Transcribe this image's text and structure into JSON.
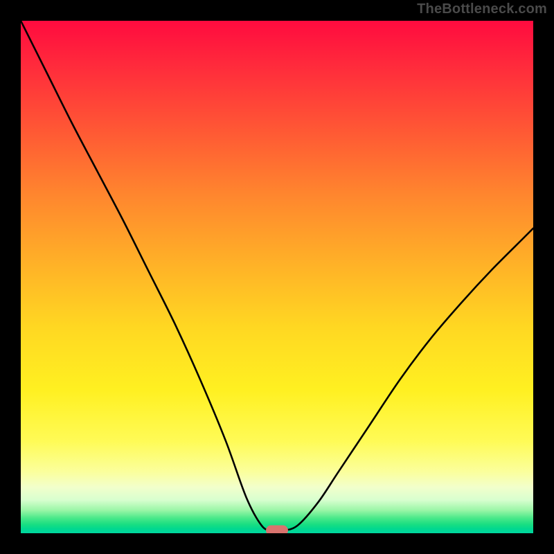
{
  "watermark": "TheBottleneck.com",
  "colors": {
    "frame": "#000000",
    "curve": "#000000",
    "marker": "#d9736e",
    "gradient_top": "#ff0b3f",
    "gradient_bottom": "#00d6a0"
  },
  "chart_data": {
    "type": "line",
    "title": "",
    "xlabel": "",
    "ylabel": "",
    "xlim": [
      0,
      100
    ],
    "ylim": [
      0,
      100
    ],
    "note": "Axes are unlabeled; values are read as percentages of the plot area. y=100 at top, y=0 at bottom.",
    "series": [
      {
        "name": "curve",
        "x": [
          0,
          5,
          10,
          15,
          20,
          25,
          30,
          35,
          40,
          44,
          47,
          49,
          51,
          54,
          58,
          62,
          68,
          74,
          80,
          86,
          92,
          98,
          100
        ],
        "y": [
          100,
          90,
          80,
          70.5,
          61,
          51,
          41,
          30,
          18,
          7,
          1.5,
          0.5,
          0.5,
          1.5,
          6,
          12,
          21,
          30,
          38,
          45,
          51.5,
          57.5,
          59.5
        ]
      }
    ],
    "marker": {
      "x": 50,
      "y": 0.5,
      "shape": "rounded-rect",
      "color": "#d9736e"
    },
    "background": {
      "type": "vertical-gradient",
      "description": "red at top through orange and yellow to a thin green band at the bottom"
    }
  }
}
